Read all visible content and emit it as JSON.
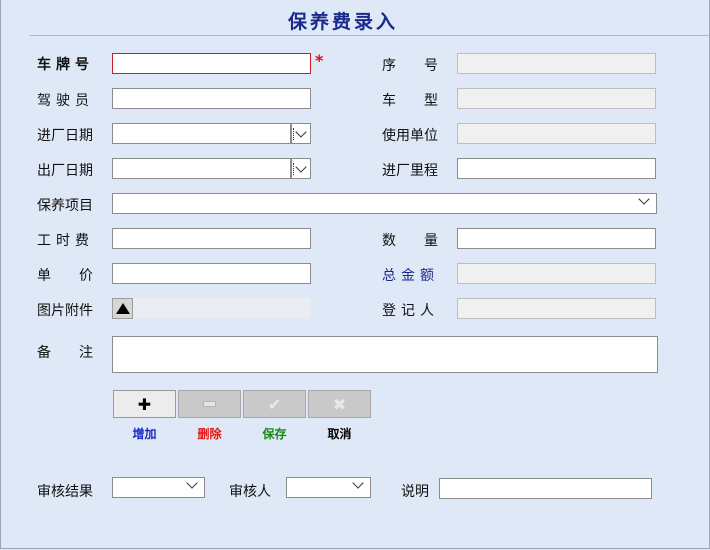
{
  "title": "保养费录入",
  "form": {
    "plate_label": "车牌号",
    "required_mark": "*",
    "driver_label": "驾驶员",
    "entry_date_label": "进厂日期",
    "exit_date_label": "出厂日期",
    "item_label": "保养项目",
    "labor_label": "工时费",
    "unit_price_label": "单价",
    "attachment_label": "图片附件",
    "remark_label": "备注",
    "seq_label": "序号",
    "model_label": "车型",
    "user_unit_label": "使用单位",
    "entry_mileage_label": "进厂里程",
    "qty_label": "数量",
    "total_label": "总金额",
    "recorder_label": "登记人"
  },
  "toolbar": {
    "add_label": "增加",
    "delete_label": "删除",
    "save_label": "保存",
    "cancel_label": "取消",
    "add_color": "#1a2ac8",
    "delete_color": "#e01818",
    "save_color": "#168a16",
    "cancel_color": "#000000",
    "add_icon": "plus-icon",
    "delete_icon": "minus-icon",
    "save_icon": "check-icon",
    "cancel_icon": "x-icon"
  },
  "review": {
    "result_label": "审核结果",
    "reviewer_label": "审核人",
    "note_label": "说明"
  },
  "colors": {
    "background": "#dfe8f6",
    "title": "#1a2a8c",
    "required": "#d01010"
  }
}
